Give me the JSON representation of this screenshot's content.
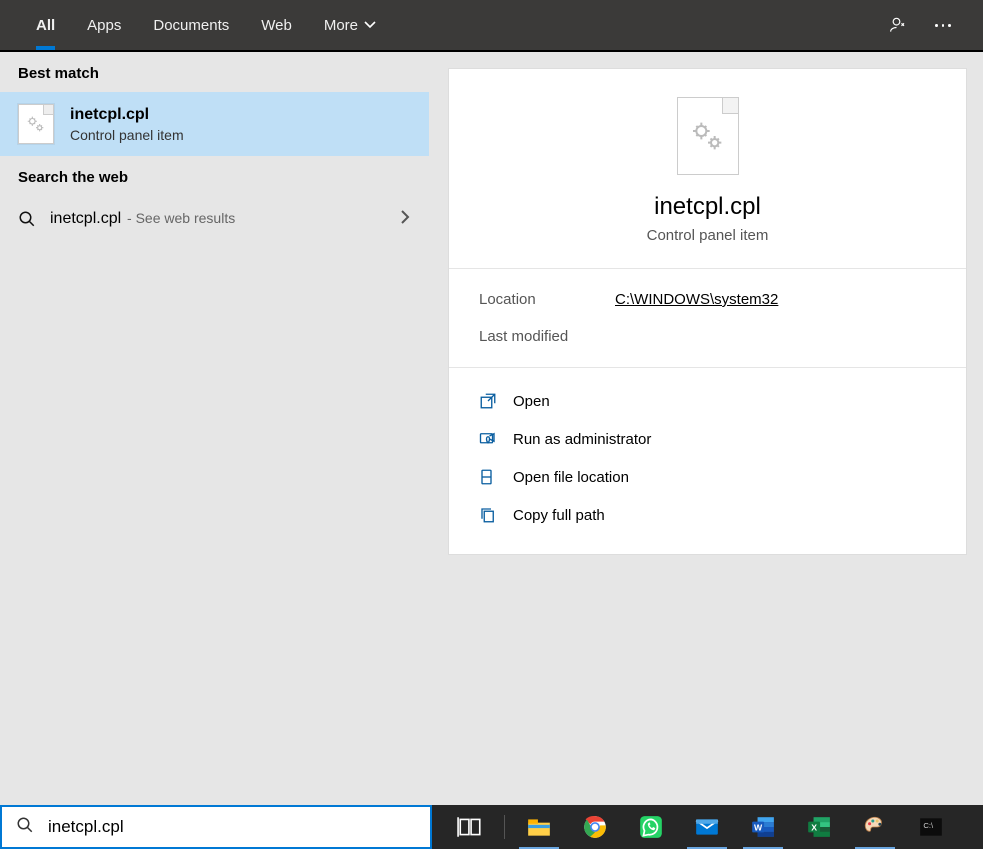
{
  "topbar": {
    "tabs": {
      "all": "All",
      "apps": "Apps",
      "documents": "Documents",
      "web": "Web",
      "more": "More"
    }
  },
  "left": {
    "best_match_header": "Best match",
    "best_match": {
      "title": "inetcpl.cpl",
      "subtitle": "Control panel item"
    },
    "search_web_header": "Search the web",
    "web_result": {
      "term": "inetcpl.cpl",
      "suffix": " - See web results"
    }
  },
  "preview": {
    "title": "inetcpl.cpl",
    "subtitle": "Control panel item",
    "location_label": "Location",
    "location_value": "C:\\WINDOWS\\system32",
    "last_modified_label": "Last modified",
    "last_modified_value": "",
    "actions": {
      "open": "Open",
      "run_admin": "Run as administrator",
      "open_loc": "Open file location",
      "copy_path": "Copy full path"
    }
  },
  "search": {
    "value": "inetcpl.cpl"
  }
}
